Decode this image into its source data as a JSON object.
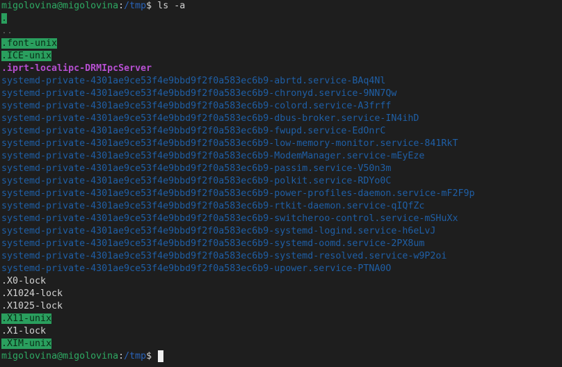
{
  "terminal": {
    "prompt1": {
      "user_host": "migolovina@migolovina",
      "sep": ":",
      "path": "/tmp",
      "symbol": "$ ",
      "command": "ls -a"
    },
    "entries": {
      "dot": ".",
      "dotdot": "..",
      "font_unix": ".font-unix",
      "ice_unix": ".ICE-unix",
      "iprt": ".iprt-localipc-DRMIpcServer",
      "services": [
        "systemd-private-4301ae9ce53f4e9bbd9f2f0a583ec6b9-abrtd.service-BAq4Nl",
        "systemd-private-4301ae9ce53f4e9bbd9f2f0a583ec6b9-chronyd.service-9NN7Qw",
        "systemd-private-4301ae9ce53f4e9bbd9f2f0a583ec6b9-colord.service-A3frff",
        "systemd-private-4301ae9ce53f4e9bbd9f2f0a583ec6b9-dbus-broker.service-IN4ihD",
        "systemd-private-4301ae9ce53f4e9bbd9f2f0a583ec6b9-fwupd.service-EdOnrC",
        "systemd-private-4301ae9ce53f4e9bbd9f2f0a583ec6b9-low-memory-monitor.service-841RkT",
        "systemd-private-4301ae9ce53f4e9bbd9f2f0a583ec6b9-ModemManager.service-mEyEze",
        "systemd-private-4301ae9ce53f4e9bbd9f2f0a583ec6b9-passim.service-V50n3m",
        "systemd-private-4301ae9ce53f4e9bbd9f2f0a583ec6b9-polkit.service-RDYo0C",
        "systemd-private-4301ae9ce53f4e9bbd9f2f0a583ec6b9-power-profiles-daemon.service-mF2F9p",
        "systemd-private-4301ae9ce53f4e9bbd9f2f0a583ec6b9-rtkit-daemon.service-qIQfZc",
        "systemd-private-4301ae9ce53f4e9bbd9f2f0a583ec6b9-switcheroo-control.service-mSHuXx",
        "systemd-private-4301ae9ce53f4e9bbd9f2f0a583ec6b9-systemd-logind.service-h6eLvJ",
        "systemd-private-4301ae9ce53f4e9bbd9f2f0a583ec6b9-systemd-oomd.service-2PX8um",
        "systemd-private-4301ae9ce53f4e9bbd9f2f0a583ec6b9-systemd-resolved.service-w9P2oi",
        "systemd-private-4301ae9ce53f4e9bbd9f2f0a583ec6b9-upower.service-PTNA0O"
      ],
      "x0_lock": ".X0-lock",
      "x1024_lock": ".X1024-lock",
      "x1025_lock": ".X1025-lock",
      "x11_unix": ".X11-unix",
      "x1_lock": ".X1-lock",
      "xim_unix": ".XIM-unix"
    },
    "prompt2": {
      "user_host": "migolovina@migolovina",
      "sep": ":",
      "path": "/tmp",
      "symbol": "$ "
    },
    "colors": {
      "background": "#1e1e1e",
      "highlight": "#2a9f5e",
      "service": "#1f5fa6",
      "magenta": "#b64fd1",
      "prompt_user": "#2eaa63",
      "prompt_path": "#2a63b8"
    }
  }
}
